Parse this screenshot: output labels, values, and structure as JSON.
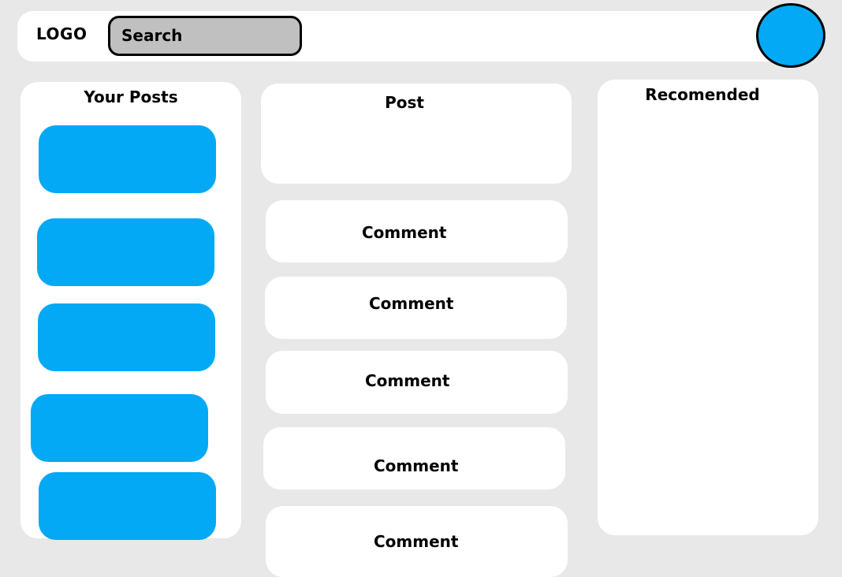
{
  "header": {
    "logo": "LOGO",
    "search_label": "Search"
  },
  "your_posts": {
    "title": "Your Posts"
  },
  "post": {
    "title": "Post"
  },
  "comments": [
    {
      "label": "Comment"
    },
    {
      "label": "Comment"
    },
    {
      "label": "Comment"
    },
    {
      "label": "Comment"
    },
    {
      "label": "Comment"
    }
  ],
  "recommended": {
    "title": "Recomended"
  },
  "colors": {
    "background": "#e8e8e8",
    "panel": "#ffffff",
    "accent": "#03a9f4",
    "search_fill": "#c0c0c0",
    "outline": "#000000"
  }
}
